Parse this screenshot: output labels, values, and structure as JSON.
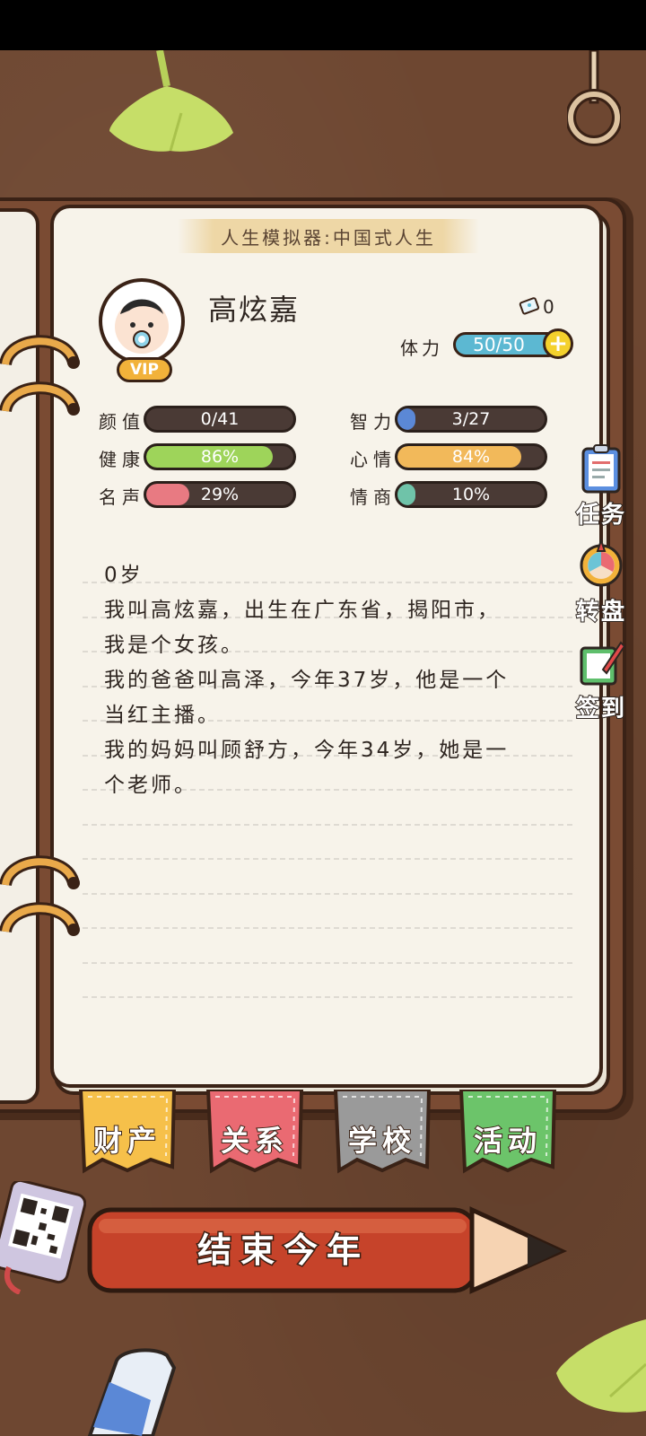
{
  "game": {
    "title": "人生模拟器:中国式人生"
  },
  "profile": {
    "name": "高炫嘉",
    "vip_label": "VIP",
    "ticket_count": "0",
    "stamina_label": "体力",
    "stamina_value": "50/50",
    "stamina_fraction": 1.0
  },
  "stats": [
    {
      "label": "颜值",
      "value": "0/41",
      "fraction": 0.0,
      "color": "#e6e6e6"
    },
    {
      "label": "智力",
      "value": "3/27",
      "fraction": 0.11,
      "color": "#5b88d6"
    },
    {
      "label": "健康",
      "value": "86%",
      "fraction": 0.86,
      "color": "#9ed45a"
    },
    {
      "label": "心情",
      "value": "84%",
      "fraction": 0.84,
      "color": "#f2b95a"
    },
    {
      "label": "名声",
      "value": "29%",
      "fraction": 0.29,
      "color": "#e87a82"
    },
    {
      "label": "情商",
      "value": "10%",
      "fraction": 0.1,
      "color": "#6fc3a9"
    }
  ],
  "story": {
    "age_line": "0岁",
    "lines": [
      "我叫高炫嘉，出生在广东省，揭阳市，",
      "我是个女孩。",
      "我的爸爸叫高泽，今年37岁，他是一个",
      "当红主播。",
      "我的妈妈叫顾舒方，今年34岁，她是一",
      "个老师。"
    ]
  },
  "side_buttons": [
    {
      "label": "任务",
      "icon": "clipboard-icon"
    },
    {
      "label": "转盘",
      "icon": "wheel-icon"
    },
    {
      "label": "签到",
      "icon": "sign-in-book-icon"
    }
  ],
  "tabs": [
    {
      "label": "财产",
      "color": "#f6c04a"
    },
    {
      "label": "关系",
      "color": "#ea6a72"
    },
    {
      "label": "学校",
      "color": "#9a9a9a"
    },
    {
      "label": "活动",
      "color": "#6cc46a"
    }
  ],
  "end_year_label": "结束今年"
}
